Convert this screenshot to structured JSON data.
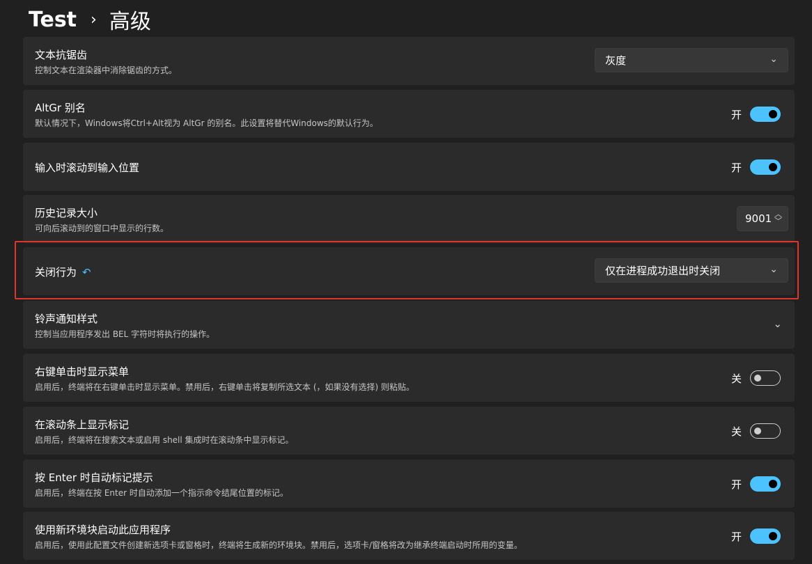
{
  "breadcrumb": {
    "parent": "Test",
    "separator": "›",
    "current": "高级"
  },
  "settings": {
    "antialias": {
      "title": "文本抗锯齿",
      "desc": "控制文本在渲染器中消除锯齿的方式。",
      "value": "灰度"
    },
    "altgr": {
      "title": "AltGr 别名",
      "desc": "默认情况下，Windows将Ctrl+Alt视为 AltGr 的别名。此设置将替代Windows的默认行为。",
      "state": "开"
    },
    "scroll_input": {
      "title": "输入时滚动到输入位置",
      "state": "开"
    },
    "history": {
      "title": "历史记录大小",
      "desc": "可向后滚动到的窗口中显示的行数。",
      "value": "9001"
    },
    "close": {
      "title": "关闭行为",
      "value": "仅在进程成功退出时关闭"
    },
    "bell": {
      "title": "铃声通知样式",
      "desc": "控制当应用程序发出 BEL 字符时将执行的操作。"
    },
    "right_click": {
      "title": "右键单击时显示菜单",
      "desc": "启用后，终端将在右键单击时显示菜单。禁用后，右键单击将复制所选文本 (，如果没有选择) 则粘贴。",
      "state": "关"
    },
    "scrollbar_marks": {
      "title": "在滚动条上显示标记",
      "desc": "启用后，终端将在搜索文本或启用 shell 集成时在滚动条中显示标记。",
      "state": "关"
    },
    "enter_mark": {
      "title": "按 Enter 时自动标记提示",
      "desc": "启用后，终端在按 Enter 时自动添加一个指示命令结尾位置的标记。",
      "state": "开"
    },
    "new_env": {
      "title": "使用新环境块启动此应用程序",
      "desc": "启用后，使用此配置文件创建新选项卡或窗格时，终端将生成新的环境块。禁用后，选项卡/窗格将改为继承终端启动时所用的变量。",
      "state": "开"
    }
  },
  "colors": {
    "accent": "#4cc2ff",
    "highlight": "#e0352b",
    "card": "#2b2b2b",
    "background": "#202020"
  },
  "icons": {
    "chevron": "chevron-down-icon",
    "reset": "reset-icon",
    "spinner": "spinner-icon"
  }
}
